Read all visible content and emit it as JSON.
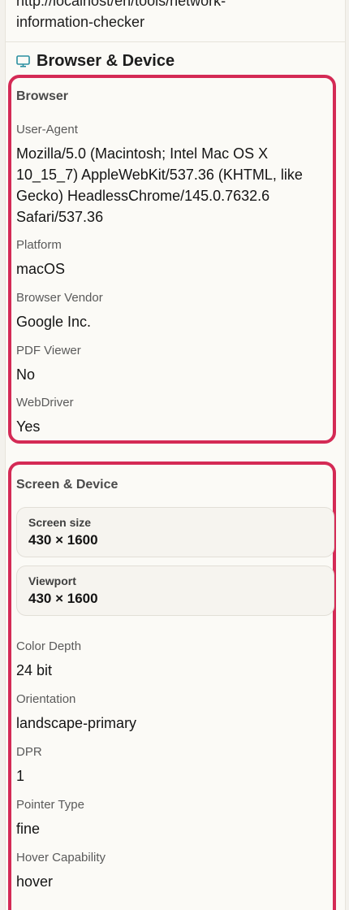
{
  "url": {
    "line1": "http://localhost/en/tools/network-",
    "line2": "information-checker"
  },
  "section": {
    "title": "Browser & Device",
    "icon": "monitor-icon"
  },
  "browser": {
    "title": "Browser",
    "user_agent_label": "User-Agent",
    "user_agent_lines": [
      "Mozilla/5.0 (Macintosh; Intel Mac OS X",
      "10_15_7) AppleWebKit/537.36 (KHTML, like",
      "Gecko) HeadlessChrome/145.0.7632.6",
      "Safari/537.36"
    ],
    "platform_label": "Platform",
    "platform_value": "macOS",
    "vendor_label": "Browser Vendor",
    "vendor_value": "Google Inc.",
    "pdf_label": "PDF Viewer",
    "pdf_value": "No",
    "webdriver_label": "WebDriver",
    "webdriver_value": "Yes"
  },
  "screen": {
    "title": "Screen & Device",
    "screen_size_label": "Screen size",
    "screen_size_value": "430 × 1600",
    "viewport_label": "Viewport",
    "viewport_value": "430 × 1600",
    "color_depth_label": "Color Depth",
    "color_depth_value": "24 bit",
    "orientation_label": "Orientation",
    "orientation_value": "landscape-primary",
    "dpr_label": "DPR",
    "dpr_value": "1",
    "pointer_label": "Pointer Type",
    "pointer_value": "fine",
    "hover_label": "Hover Capability",
    "hover_value": "hover"
  },
  "colors": {
    "highlight": "#d42a55",
    "icon": "#2a8fa0"
  }
}
